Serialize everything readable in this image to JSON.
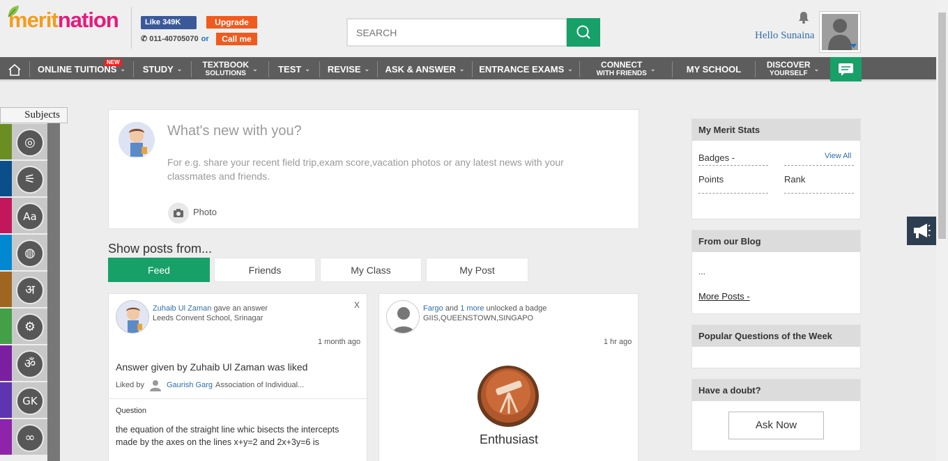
{
  "header": {
    "logo_part1": "merit",
    "logo_part2": "nation",
    "fb_like": "Like 349K",
    "phone": "011-40705070",
    "or": "or",
    "upgrade": "Upgrade",
    "call_me": "Call me",
    "search_placeholder": "SEARCH",
    "greeting": "Hello Sunaina"
  },
  "nav": {
    "items": [
      {
        "label": "ONLINE TUITIONS"
      },
      {
        "label": "STUDY"
      },
      {
        "label": "TEXTBOOK",
        "sub": "SOLUTIONS"
      },
      {
        "label": "TEST"
      },
      {
        "label": "REVISE"
      },
      {
        "label": "ASK & ANSWER"
      },
      {
        "label": "ENTRANCE EXAMS"
      },
      {
        "label": "CONNECT",
        "sub": "WITH FRIENDS"
      },
      {
        "label": "MY SCHOOL"
      },
      {
        "label": "DISCOVER",
        "sub": "YOURSELF"
      }
    ],
    "new_badge": "NEW"
  },
  "subjects": {
    "title": "Subjects",
    "items": [
      {
        "icon": "planet-icon",
        "color": "#6b8e23",
        "glyph": "◎"
      },
      {
        "icon": "compass-icon",
        "color": "#0b4f8a",
        "glyph": "⚟"
      },
      {
        "icon": "english-icon",
        "color": "#c2185b",
        "glyph": "Aa"
      },
      {
        "icon": "globe-icon",
        "color": "#0288d1",
        "glyph": "◍"
      },
      {
        "icon": "hindi-icon",
        "color": "#a0661f",
        "glyph": "अ"
      },
      {
        "icon": "gears-icon",
        "color": "#43a047",
        "glyph": "⚙"
      },
      {
        "icon": "sanskrit-icon",
        "color": "#7b1fa2",
        "glyph": "ॐ"
      },
      {
        "icon": "gk-icon",
        "color": "#5e35b1",
        "glyph": "GK"
      },
      {
        "icon": "olympics-icon",
        "color": "#8e24aa",
        "glyph": "∞"
      }
    ]
  },
  "composer": {
    "title": "What's new with you?",
    "hint": "For e.g. share your recent field trip,exam score,vacation photos or any latest news with your classmates and friends.",
    "photo": "Photo"
  },
  "feed": {
    "show_posts_label": "Show posts from...",
    "tabs": [
      "Feed",
      "Friends",
      "My Class",
      "My Post"
    ]
  },
  "posts": [
    {
      "author": "Zuhaib Ul Zaman",
      "action": "gave an answer",
      "school": "Leeds Convent School, Srinagar",
      "close": "X",
      "time": "1 month ago",
      "headline": "Answer given by Zuhaib Ul Zaman was liked",
      "liked_by_label": "Liked by",
      "liked_by_name": "Gaurish Garg",
      "liked_by_school": "Association of Individual...",
      "section_label": "Question",
      "question": "the equation of the straight line whic bisects the intercepts made by the axes on the lines x+y=2 and 2x+3y=6 is"
    },
    {
      "author": "Fargo",
      "and": "and",
      "more": "1 more",
      "action": "unlocked a badge",
      "school": "GIIS,QUEENSTOWN,SINGAPO",
      "time": "1 hr ago",
      "badge": "Enthusiast"
    }
  ],
  "sidebar": {
    "stats_title": "My Merit Stats",
    "badges": "Badges -",
    "view_all": "View All",
    "points": "Points",
    "rank": "Rank",
    "blog_title": "From our Blog",
    "blog_body": "...",
    "more_posts": "More Posts -",
    "popular_title": "Popular Questions of the Week",
    "doubt_title": "Have a doubt?",
    "ask_now": "Ask Now"
  }
}
